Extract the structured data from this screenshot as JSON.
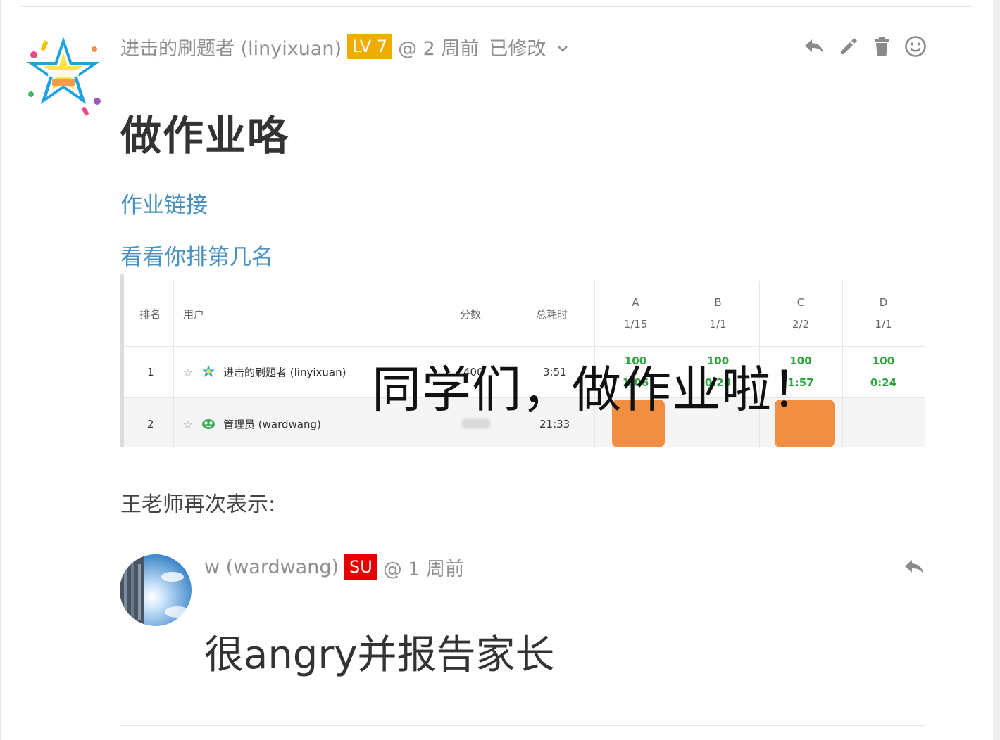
{
  "post": {
    "author": "进击的刷题者 (linyixuan)",
    "level": "LV 7",
    "time": "@ 2 周前",
    "edited": "已修改",
    "title": "做作业咯",
    "link_homework": "作业链接",
    "link_rank": "看看你排第几名",
    "paragraph": "王老师再次表示:"
  },
  "actions": {
    "icons": [
      "reply-icon",
      "edit-icon",
      "delete-icon",
      "emoji-icon"
    ]
  },
  "scoreboard": {
    "headers": {
      "rank": "排名",
      "user": "用户",
      "score": "分数",
      "time": "总耗时",
      "problems": [
        {
          "letter": "A",
          "ratio": "1/15"
        },
        {
          "letter": "B",
          "ratio": "1/1"
        },
        {
          "letter": "C",
          "ratio": "2/2"
        },
        {
          "letter": "D",
          "ratio": "1/1"
        }
      ]
    },
    "rows": [
      {
        "rank": "1",
        "user": "进击的刷题者 (linyixuan)",
        "score": "400",
        "time": "3:51",
        "cells": [
          {
            "score": "100",
            "time": "1:06"
          },
          {
            "score": "100",
            "time": "0:28"
          },
          {
            "score": "100",
            "time": "1:57"
          },
          {
            "score": "100",
            "time": "0:24"
          }
        ]
      },
      {
        "rank": "2",
        "user": "管理员 (wardwang)",
        "score": "",
        "time": "21:33",
        "cells": []
      }
    ],
    "overlay_caption": "同学们，做作业啦！",
    "accent_green": "#2aa63d",
    "accent_orange": "#f28e42"
  },
  "reply": {
    "author": "w (wardwang)",
    "badge": "SU",
    "time": "@ 1 周前",
    "body": "很angry并报告家长"
  },
  "colors": {
    "link": "#4a90c2",
    "level_badge": "#f0ad00",
    "su_badge": "#e60000",
    "meta_text": "#8f8f8f"
  }
}
